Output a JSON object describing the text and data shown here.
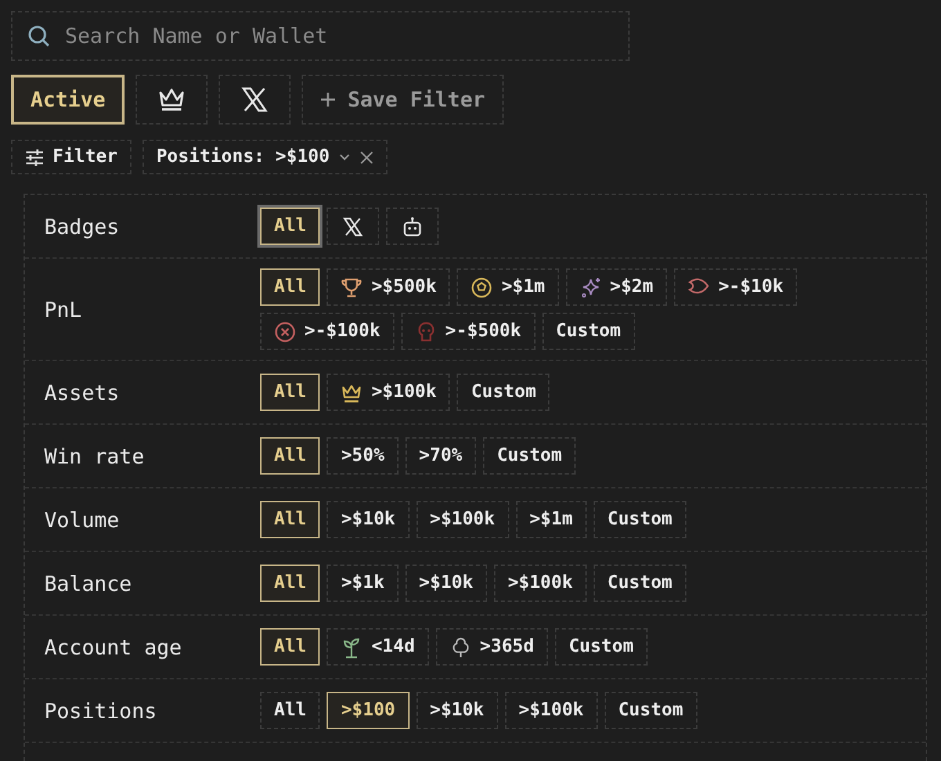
{
  "search": {
    "placeholder": "Search Name or Wallet"
  },
  "presets": [
    {
      "kind": "text",
      "label": "Active",
      "selected": true
    },
    {
      "kind": "crown",
      "selected": false
    },
    {
      "kind": "x-logo",
      "selected": false
    },
    {
      "kind": "add",
      "label": "Save Filter",
      "selected": false
    }
  ],
  "filter_button": {
    "label": "Filter"
  },
  "active_filters": [
    {
      "label": "Positions: >$100"
    }
  ],
  "sections": [
    {
      "label": "Badges",
      "options": [
        {
          "kind": "plain",
          "label": "All",
          "selected": true,
          "focused": true
        },
        {
          "kind": "x-logo",
          "selected": false,
          "focused": false
        },
        {
          "kind": "robot",
          "selected": false,
          "focused": false
        }
      ]
    },
    {
      "label": "PnL",
      "options": [
        {
          "kind": "plain",
          "label": "All",
          "selected": true
        },
        {
          "kind": "trophy",
          "label": ">$500k",
          "selected": false
        },
        {
          "kind": "medal",
          "label": ">$1m",
          "selected": false
        },
        {
          "kind": "sparkle",
          "label": ">$2m",
          "selected": false
        },
        {
          "kind": "fish",
          "label": ">-$10k",
          "selected": false
        },
        {
          "kind": "xcircle",
          "label": ">-$100k",
          "selected": false
        },
        {
          "kind": "skull",
          "label": ">-$500k",
          "selected": false
        },
        {
          "kind": "plain",
          "label": "Custom",
          "selected": false
        }
      ]
    },
    {
      "label": "Assets",
      "options": [
        {
          "kind": "plain",
          "label": "All",
          "selected": true
        },
        {
          "kind": "crown",
          "label": ">$100k",
          "selected": false
        },
        {
          "kind": "plain",
          "label": "Custom",
          "selected": false
        }
      ]
    },
    {
      "label": "Win rate",
      "options": [
        {
          "kind": "plain",
          "label": "All",
          "selected": true
        },
        {
          "kind": "plain",
          "label": ">50%",
          "selected": false
        },
        {
          "kind": "plain",
          "label": ">70%",
          "selected": false
        },
        {
          "kind": "plain",
          "label": "Custom",
          "selected": false
        }
      ]
    },
    {
      "label": "Volume",
      "options": [
        {
          "kind": "plain",
          "label": "All",
          "selected": true
        },
        {
          "kind": "plain",
          "label": ">$10k",
          "selected": false
        },
        {
          "kind": "plain",
          "label": ">$100k",
          "selected": false
        },
        {
          "kind": "plain",
          "label": ">$1m",
          "selected": false
        },
        {
          "kind": "plain",
          "label": "Custom",
          "selected": false
        }
      ]
    },
    {
      "label": "Balance",
      "options": [
        {
          "kind": "plain",
          "label": "All",
          "selected": true
        },
        {
          "kind": "plain",
          "label": ">$1k",
          "selected": false
        },
        {
          "kind": "plain",
          "label": ">$10k",
          "selected": false
        },
        {
          "kind": "plain",
          "label": ">$100k",
          "selected": false
        },
        {
          "kind": "plain",
          "label": "Custom",
          "selected": false
        }
      ]
    },
    {
      "label": "Account age",
      "options": [
        {
          "kind": "plain",
          "label": "All",
          "selected": true
        },
        {
          "kind": "sprout",
          "label": "<14d",
          "selected": false
        },
        {
          "kind": "tree",
          "label": ">365d",
          "selected": false
        },
        {
          "kind": "plain",
          "label": "Custom",
          "selected": false
        }
      ]
    },
    {
      "label": "Positions",
      "options": [
        {
          "kind": "plain",
          "label": "All",
          "selected": false
        },
        {
          "kind": "plain",
          "label": ">$100",
          "selected": true
        },
        {
          "kind": "plain",
          "label": ">$10k",
          "selected": false
        },
        {
          "kind": "plain",
          "label": ">$100k",
          "selected": false
        },
        {
          "kind": "plain",
          "label": "Custom",
          "selected": false
        }
      ]
    }
  ]
}
